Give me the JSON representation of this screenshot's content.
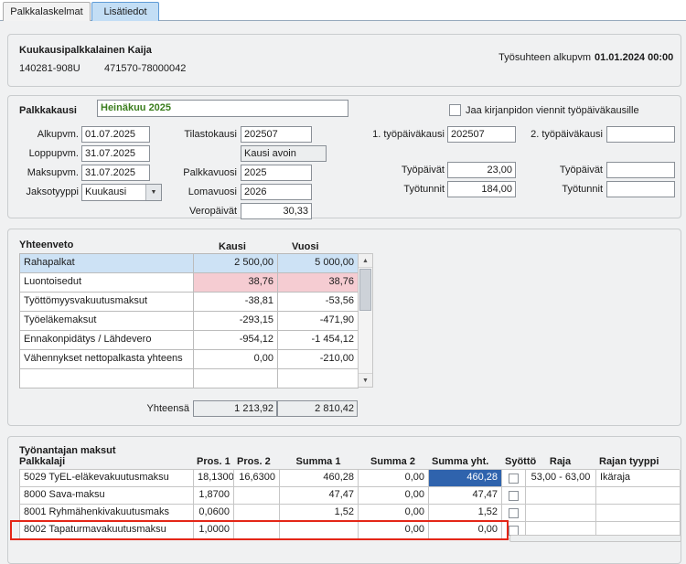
{
  "tabs": {
    "tab1": "Palkkalaskelmat",
    "tab2": "Lisätiedot"
  },
  "employee": {
    "name": "Kuukausipalkkalainen Kaija",
    "personal_id": "140281-908U",
    "employment_id": "471570-78000042",
    "employment_start_label": "Työsuhteen alkupvm",
    "employment_start": "01.01.2024 00:00"
  },
  "period": {
    "group_title": "Palkkakausi",
    "period_name": "Heinäkuu 2025",
    "split_checkbox_label": "Jaa kirjanpidon viennit työpäiväkausille",
    "alkupvm_label": "Alkupvm.",
    "alkupvm": "01.07.2025",
    "loppupvm_label": "Loppupvm.",
    "loppupvm": "31.07.2025",
    "maksupvm_label": "Maksupvm.",
    "maksupvm": "31.07.2025",
    "jaksotyyppi_label": "Jaksotyyppi",
    "jaksotyyppi": "Kuukausi",
    "tilastokausi_label": "Tilastokausi",
    "tilastokausi": "202507",
    "kausi_status": "Kausi avoin",
    "palkkavuosi_label": "Palkkavuosi",
    "palkkavuosi": "2025",
    "lomavuosi_label": "Lomavuosi",
    "lomavuosi": "2026",
    "veropaivat_label": "Veropäivät",
    "veropaivat": "30,33",
    "tyopaivakausi1_label": "1. työpäiväkausi",
    "tyopaivakausi1": "202507",
    "tyopaivakausi2_label": "2. työpäiväkausi",
    "tyopaivakausi2": "",
    "tyopaivat_label": "Työpäivät",
    "tyopaivat1": "23,00",
    "tyopaivat2": "",
    "tyotunnit_label": "Työtunnit",
    "tyotunnit1": "184,00",
    "tyotunnit2": ""
  },
  "summary": {
    "group_title": "Yhteenveto",
    "col_kausi": "Kausi",
    "col_vuosi": "Vuosi",
    "rows": [
      {
        "label": "Rahapalkat",
        "kausi": "2 500,00",
        "vuosi": "5 000,00"
      },
      {
        "label": "Luontoisedut",
        "kausi": "38,76",
        "vuosi": "38,76"
      },
      {
        "label": "Työttömyysvakuutusmaksut",
        "kausi": "-38,81",
        "vuosi": "-53,56"
      },
      {
        "label": "Työeläkemaksut",
        "kausi": "-293,15",
        "vuosi": "-471,90"
      },
      {
        "label": "Ennakonpidätys / Lähdevero",
        "kausi": "-954,12",
        "vuosi": "-1 454,12"
      },
      {
        "label": "Vähennykset nettopalkasta yhteens",
        "kausi": "0,00",
        "vuosi": "-210,00"
      },
      {
        "label": "",
        "kausi": "",
        "vuosi": ""
      }
    ],
    "total_label": "Yhteensä",
    "total_kausi": "1 213,92",
    "total_vuosi": "2 810,42"
  },
  "employer": {
    "group_title": "Työnantajan maksut",
    "headers": {
      "palkkalaji": "Palkkalaji",
      "pros1": "Pros. 1",
      "pros2": "Pros. 2",
      "summa1": "Summa 1",
      "summa2": "Summa 2",
      "summa_yht": "Summa yht.",
      "syotto": "Syöttö",
      "raja": "Raja",
      "rajan_tyyppi": "Rajan tyyppi"
    },
    "rows": [
      {
        "palkkalaji": "5029 TyEL-eläkevakuutusmaksu",
        "pros1": "18,1300",
        "pros2": "16,6300",
        "summa1": "460,28",
        "summa2": "0,00",
        "summa_yht": "460,28",
        "raja": "53,00 - 63,00",
        "rajan_tyyppi": "Ikäraja"
      },
      {
        "palkkalaji": "8000 Sava-maksu",
        "pros1": "1,8700",
        "pros2": "",
        "summa1": "47,47",
        "summa2": "0,00",
        "summa_yht": "47,47",
        "raja": "",
        "rajan_tyyppi": ""
      },
      {
        "palkkalaji": "8001 Ryhmähenkivakuutusmaks",
        "pros1": "0,0600",
        "pros2": "",
        "summa1": "1,52",
        "summa2": "0,00",
        "summa_yht": "1,52",
        "raja": "",
        "rajan_tyyppi": ""
      },
      {
        "palkkalaji": "8002 Tapaturmavakuutusmaksu",
        "pros1": "1,0000",
        "pros2": "",
        "summa1": "",
        "summa2": "0,00",
        "summa_yht": "0,00",
        "raja": "",
        "rajan_tyyppi": ""
      }
    ]
  },
  "icons": {
    "chevron_down": "▼",
    "scroll_up": "▲",
    "scroll_down": "▼"
  },
  "colors": {
    "active_tab_bg": "#c3def5",
    "period_text_green": "#3b7e1e",
    "summary_row_blue": "#cde2f5",
    "summary_row_pink": "#f5ccd2",
    "selected_cell_blue": "#2f63ad",
    "highlight_red": "#e42617"
  }
}
